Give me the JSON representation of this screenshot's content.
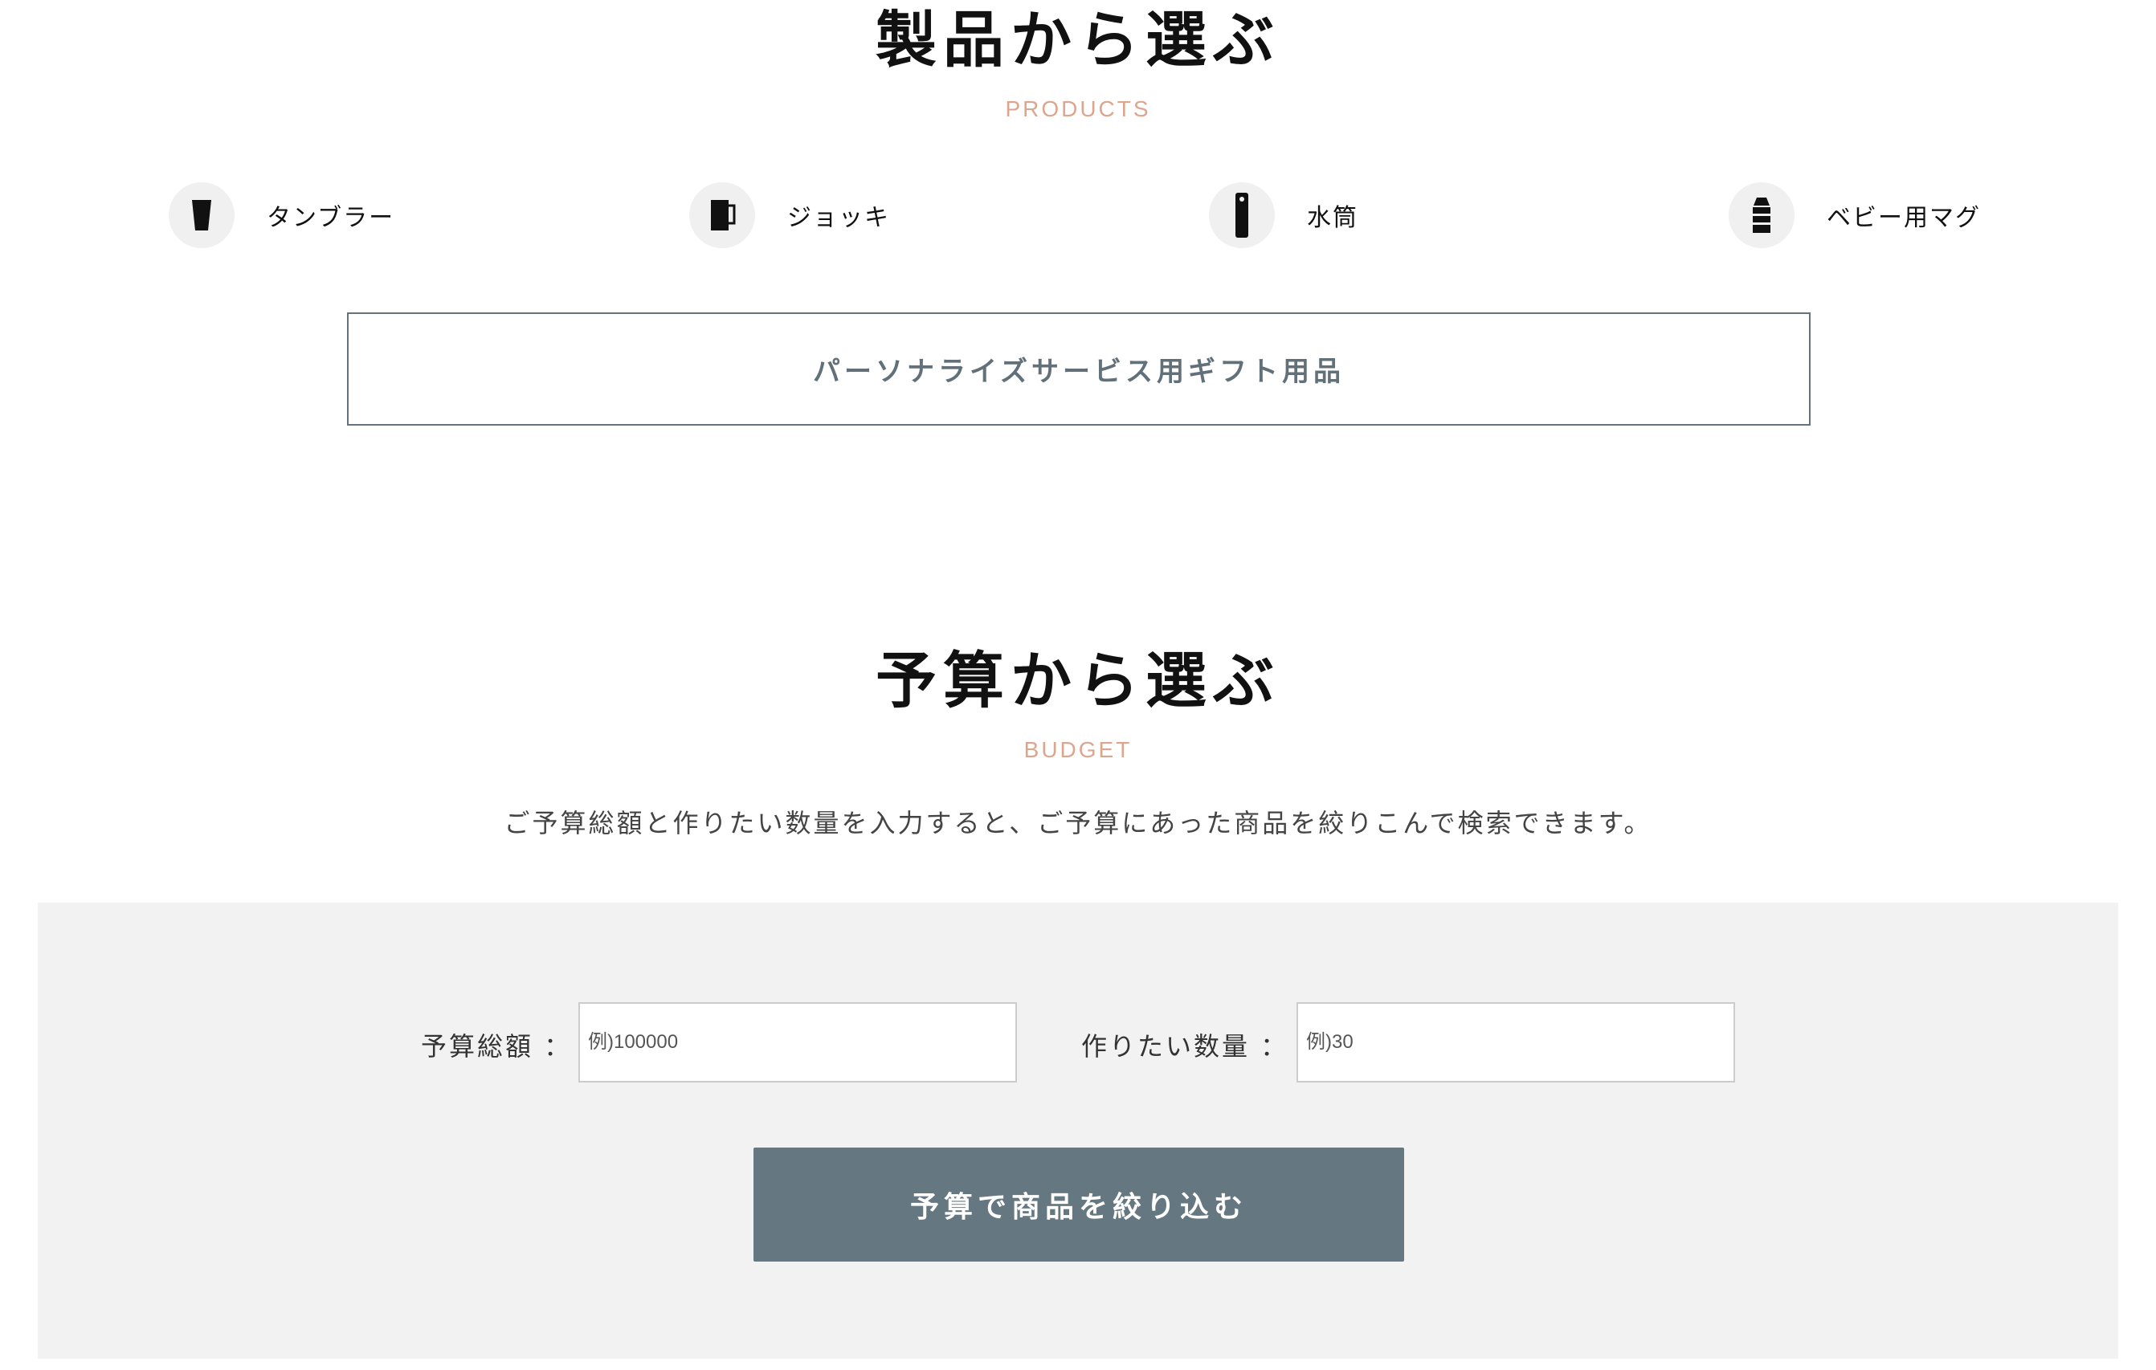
{
  "products_section": {
    "title": "製品から選ぶ",
    "subtitle": "PRODUCTS",
    "items": [
      {
        "label": "タンブラー",
        "icon": "tumbler-icon"
      },
      {
        "label": "ジョッキ",
        "icon": "mug-icon"
      },
      {
        "label": "水筒",
        "icon": "water-bottle-icon"
      },
      {
        "label": "ベビー用マグ",
        "icon": "baby-mug-icon"
      }
    ],
    "gift_button_label": "パーソナライズサービス用ギフト用品"
  },
  "budget_section": {
    "title": "予算から選ぶ",
    "subtitle": "BUDGET",
    "description": "ご予算総額と作りたい数量を入力すると、ご予算にあった商品を絞りこんで検索できます。",
    "total_label": "予算総額 ：",
    "total_placeholder": "例)100000",
    "quantity_label": "作りたい数量 ：",
    "quantity_placeholder": "例)30",
    "submit_label": "予算で商品を絞り込む"
  },
  "colors": {
    "accent": "#dca58e",
    "button": "#657780",
    "panel_bg": "#f2f2f2"
  }
}
